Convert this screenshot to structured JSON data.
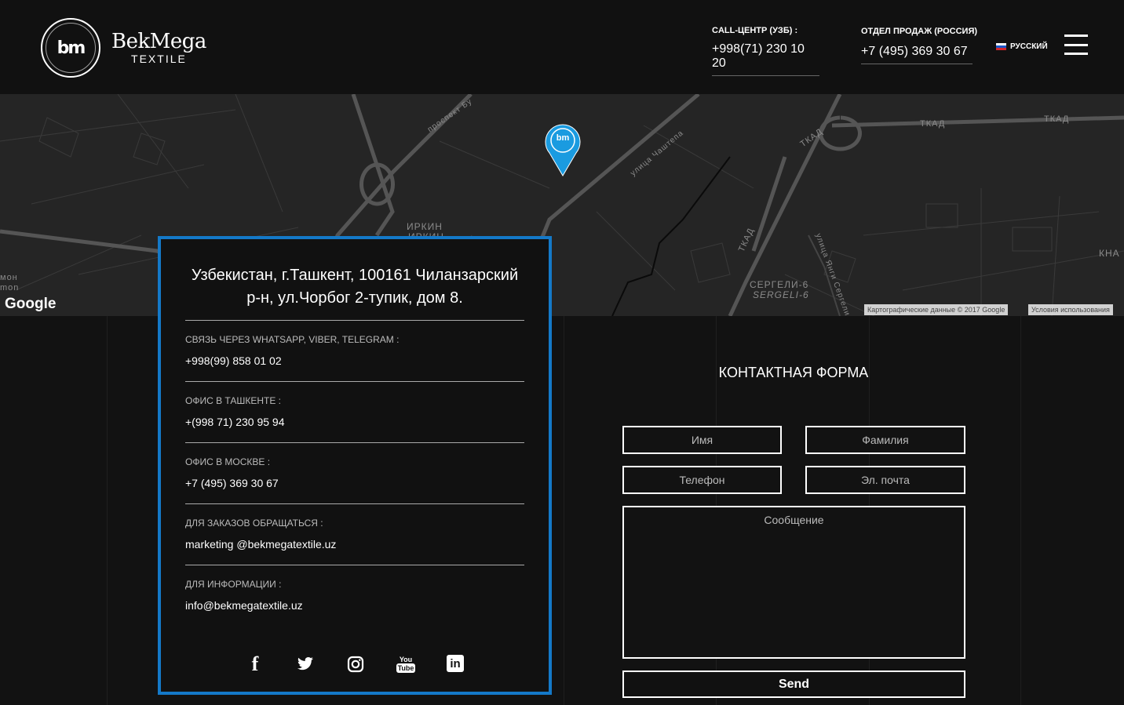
{
  "brand": {
    "logo_mark": "bm",
    "name": "BekMega",
    "sub": "TEXTILE"
  },
  "header": {
    "call_center_label": "CALL-ЦЕНТР (УЗБ) :",
    "call_center_phone": "+998(71) 230 10 20",
    "sales_label": "ОТДЕЛ ПРОДАЖ (РОССИЯ)",
    "sales_phone": "+7 (495) 369 30 67",
    "language": "РУССКИЙ",
    "menu_icon": "hamburger-icon"
  },
  "map": {
    "labels": [
      "проспект Бу",
      "улица Чаштепа",
      "ТКАД",
      "ТКАД",
      "ТКАД",
      "ТКАД",
      "ИРКИН",
      "ИРКИН",
      "СЕРГЕЛИ-6",
      "SERGELI-6",
      "улица Янги Сергели",
      "КНА",
      "мон",
      "mon"
    ],
    "google": "Google",
    "attribution": "Картографические данные © 2017 Google",
    "terms": "Условия использования",
    "pin_logo": "bm"
  },
  "contact": {
    "address": "Узбекистан, г.Ташкент, 100161 Чиланзарский р-н, ул.Чорбог 2-тупик, дом 8.",
    "rows": [
      {
        "label": "СВЯЗЬ ЧЕРЕЗ WHATSAPP, VIBER, TELEGRAM :",
        "value": "+998(99) 858 01 02"
      },
      {
        "label": "ОФИС В ТАШКЕНТЕ :",
        "value": "+(998 71) 230 95 94"
      },
      {
        "label": "ОФИС В МОСКВЕ :",
        "value": "+7 (495) 369 30 67"
      },
      {
        "label": "ДЛЯ ЗАКАЗОВ ОБРАЩАТЬСЯ :",
        "value": "marketing @bekmegatextile.uz"
      },
      {
        "label": "ДЛЯ ИНФОРМАЦИИ :",
        "value": "info@bekmegatextile.uz"
      }
    ],
    "socials": [
      "facebook-icon",
      "twitter-icon",
      "instagram-icon",
      "youtube-icon",
      "linkedin-icon"
    ],
    "social_glyphs": {
      "facebook": "f",
      "youtube_top": "You",
      "youtube_bottom": "Tube",
      "linkedin": "in"
    }
  },
  "form": {
    "title": "КОНТАКТНАЯ ФОРМА",
    "first_name_placeholder": "Имя",
    "last_name_placeholder": "Фамилия",
    "phone_placeholder": "Телефон",
    "email_placeholder": "Эл. почта",
    "message_placeholder": "Сообщение",
    "send_label": "Send"
  }
}
